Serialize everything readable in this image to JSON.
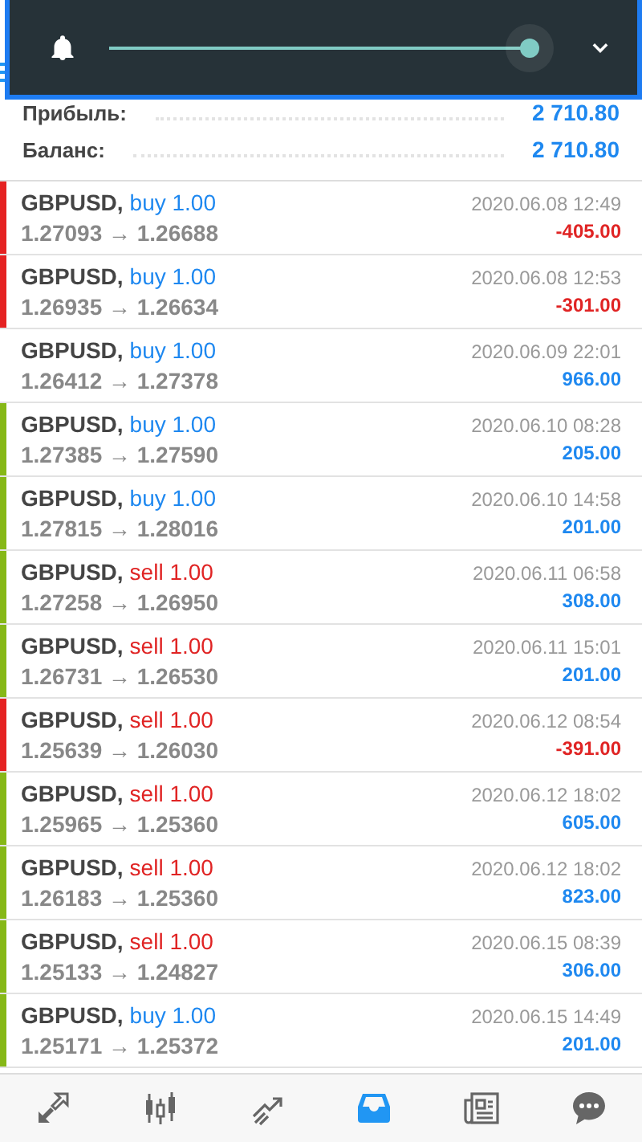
{
  "toolbar": {
    "slider": {
      "level": 1
    }
  },
  "summary": [
    {
      "label": "Прибыль:",
      "value": "2 710.80"
    },
    {
      "label": "Баланс:",
      "value": "2 710.80"
    }
  ],
  "trades": [
    {
      "symbol": "GBPUSD,",
      "kind": "buy",
      "side": "buy 1.00",
      "prices": "1.27093 → 1.26688",
      "time": "2020.06.08 12:49",
      "profit": "-405.00",
      "negative": true,
      "color": "#e52222"
    },
    {
      "symbol": "GBPUSD,",
      "kind": "buy",
      "side": "buy 1.00",
      "prices": "1.26935 → 1.26634",
      "time": "2020.06.08 12:53",
      "profit": "-301.00",
      "negative": true,
      "color": "#e52222"
    },
    {
      "symbol": "GBPUSD,",
      "kind": "buy",
      "side": "buy 1.00",
      "prices": "1.26412 → 1.27378",
      "time": "2020.06.09 22:01",
      "profit": "966.00",
      "negative": false
    },
    {
      "symbol": "GBPUSD,",
      "kind": "buy",
      "side": "buy 1.00",
      "prices": "1.27385 → 1.27590",
      "time": "2020.06.10 08:28",
      "profit": "205.00",
      "negative": false,
      "color": "#86b817"
    },
    {
      "symbol": "GBPUSD,",
      "kind": "buy",
      "side": "buy 1.00",
      "prices": "1.27815 → 1.28016",
      "time": "2020.06.10 14:58",
      "profit": "201.00",
      "negative": false,
      "color": "#86b817"
    },
    {
      "symbol": "GBPUSD,",
      "kind": "sell",
      "side": "sell 1.00",
      "prices": "1.27258 → 1.26950",
      "time": "2020.06.11 06:58",
      "profit": "308.00",
      "negative": false,
      "color": "#86b817"
    },
    {
      "symbol": "GBPUSD,",
      "kind": "sell",
      "side": "sell 1.00",
      "prices": "1.26731 → 1.26530",
      "time": "2020.06.11 15:01",
      "profit": "201.00",
      "negative": false,
      "color": "#86b817"
    },
    {
      "symbol": "GBPUSD,",
      "kind": "sell",
      "side": "sell 1.00",
      "prices": "1.25639 → 1.26030",
      "time": "2020.06.12 08:54",
      "profit": "-391.00",
      "negative": true,
      "color": "#e52222"
    },
    {
      "symbol": "GBPUSD,",
      "kind": "sell",
      "side": "sell 1.00",
      "prices": "1.25965 → 1.25360",
      "time": "2020.06.12 18:02",
      "profit": "605.00",
      "negative": false,
      "color": "#86b817"
    },
    {
      "symbol": "GBPUSD,",
      "kind": "sell",
      "side": "sell 1.00",
      "prices": "1.26183 → 1.25360",
      "time": "2020.06.12 18:02",
      "profit": "823.00",
      "negative": false,
      "color": "#86b817"
    },
    {
      "symbol": "GBPUSD,",
      "kind": "sell",
      "side": "sell 1.00",
      "prices": "1.25133 → 1.24827",
      "time": "2020.06.15 08:39",
      "profit": "306.00",
      "negative": false,
      "color": "#86b817"
    },
    {
      "symbol": "GBPUSD,",
      "kind": "buy",
      "side": "buy 1.00",
      "prices": "1.25171 → 1.25372",
      "time": "2020.06.15 14:49",
      "profit": "201.00",
      "negative": false,
      "color": "#86b817"
    }
  ],
  "nav": [
    {
      "kind": "quotes",
      "selected": false
    },
    {
      "kind": "chart",
      "selected": false
    },
    {
      "kind": "trade",
      "selected": false
    },
    {
      "kind": "history",
      "selected": true
    },
    {
      "kind": "news",
      "selected": false
    },
    {
      "kind": "chat",
      "selected": false
    }
  ]
}
